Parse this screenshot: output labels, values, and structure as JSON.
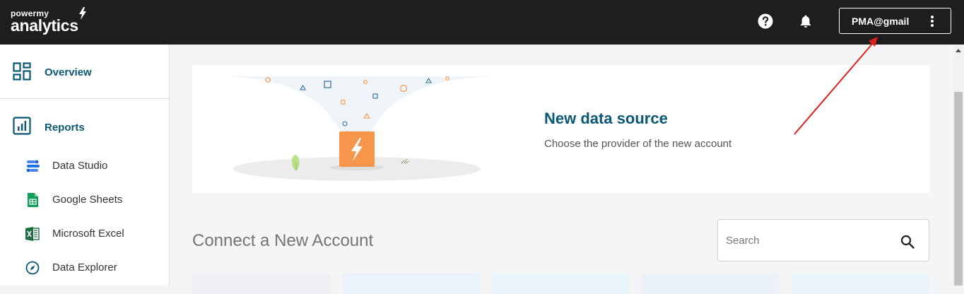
{
  "header": {
    "logo_top": "powermy",
    "logo_bottom": "analytics",
    "account_label": "PMA@gmail"
  },
  "sidebar": {
    "main_items": [
      {
        "label": "Overview"
      },
      {
        "label": "Reports"
      }
    ],
    "report_items": [
      {
        "label": "Data Studio"
      },
      {
        "label": "Google Sheets"
      },
      {
        "label": "Microsoft Excel"
      },
      {
        "label": "Data Explorer"
      }
    ]
  },
  "banner": {
    "title": "New data source",
    "subtitle": "Choose the provider of the new account"
  },
  "connect": {
    "title": "Connect a New Account",
    "search_placeholder": "Search"
  },
  "colors": {
    "topbar": "#1e1e1e",
    "accent": "#0b5876",
    "brand_orange": "#f7954a",
    "annotation_arrow": "#e02020"
  }
}
